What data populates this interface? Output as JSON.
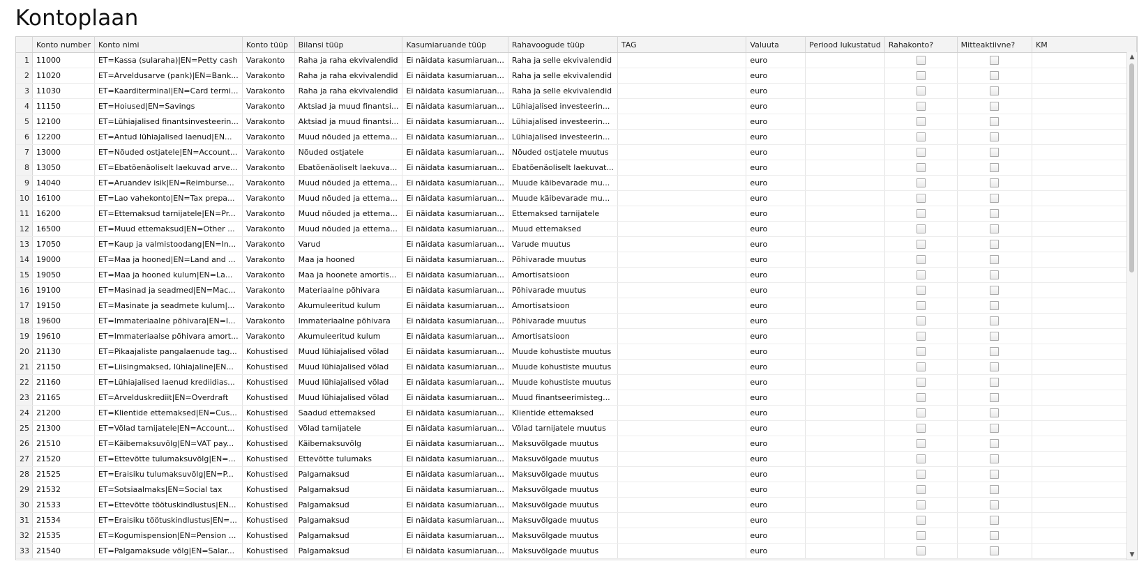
{
  "page": {
    "title": "Kontoplaan"
  },
  "columns": [
    "Konto number",
    "Konto nimi",
    "Konto tüüp",
    "Bilansi tüüp",
    "Kasumiaruande tüüp",
    "Rahavoogude tüüp",
    "TAG",
    "Valuuta",
    "Periood lukustatud",
    "Rahakonto?",
    "Mitteaktiivne?",
    "KM"
  ],
  "rows": [
    {
      "n": "1",
      "num": "11000",
      "name": "ET=Kassa (sularaha)|EN=Petty cash",
      "type": "Varakonto",
      "bal": "Raha ja raha ekvivalendid",
      "inc": "Ei näidata kasumiaruan...",
      "cf": "Raha ja selle ekvivalendid",
      "cur": "euro"
    },
    {
      "n": "2",
      "num": "11020",
      "name": "ET=Arveldusarve (pank)|EN=Bank...",
      "type": "Varakonto",
      "bal": "Raha ja raha ekvivalendid",
      "inc": "Ei näidata kasumiaruan...",
      "cf": "Raha ja selle ekvivalendid",
      "cur": "euro"
    },
    {
      "n": "3",
      "num": "11030",
      "name": "ET=Kaarditerminal|EN=Card termi...",
      "type": "Varakonto",
      "bal": "Raha ja raha ekvivalendid",
      "inc": "Ei näidata kasumiaruan...",
      "cf": "Raha ja selle ekvivalendid",
      "cur": "euro"
    },
    {
      "n": "4",
      "num": "11150",
      "name": "ET=Hoiused|EN=Savings",
      "type": "Varakonto",
      "bal": "Aktsiad ja muud finantsi...",
      "inc": "Ei näidata kasumiaruan...",
      "cf": "Lühiajalised investeerin...",
      "cur": "euro"
    },
    {
      "n": "5",
      "num": "12100",
      "name": "ET=Lühiajalised finantsinvesteerin...",
      "type": "Varakonto",
      "bal": "Aktsiad ja muud finantsi...",
      "inc": "Ei näidata kasumiaruan...",
      "cf": "Lühiajalised investeerin...",
      "cur": "euro"
    },
    {
      "n": "6",
      "num": "12200",
      "name": "ET=Antud lühiajalised laenud|EN...",
      "type": "Varakonto",
      "bal": "Muud nõuded ja ettema...",
      "inc": "Ei näidata kasumiaruan...",
      "cf": "Lühiajalised investeerin...",
      "cur": "euro"
    },
    {
      "n": "7",
      "num": "13000",
      "name": "ET=Nõuded ostjatele|EN=Account...",
      "type": "Varakonto",
      "bal": "Nõuded ostjatele",
      "inc": "Ei näidata kasumiaruan...",
      "cf": "Nõuded ostjatele muutus",
      "cur": "euro"
    },
    {
      "n": "8",
      "num": "13050",
      "name": "ET=Ebatõenäoliselt laekuvad arve...",
      "type": "Varakonto",
      "bal": "Ebatõenäoliselt laekuva...",
      "inc": "Ei näidata kasumiaruan...",
      "cf": "Ebatõenäoliselt laekuvat...",
      "cur": "euro"
    },
    {
      "n": "9",
      "num": "14040",
      "name": "ET=Aruandev isik|EN=Reimburse...",
      "type": "Varakonto",
      "bal": "Muud nõuded ja ettema...",
      "inc": "Ei näidata kasumiaruan...",
      "cf": "Muude käibevarade mu...",
      "cur": "euro"
    },
    {
      "n": "10",
      "num": "16100",
      "name": "ET=Lao vahekonto|EN=Tax prepa...",
      "type": "Varakonto",
      "bal": "Muud nõuded ja ettema...",
      "inc": "Ei näidata kasumiaruan...",
      "cf": "Muude käibevarade mu...",
      "cur": "euro"
    },
    {
      "n": "11",
      "num": "16200",
      "name": "ET=Ettemaksud tarnijatele|EN=Pr...",
      "type": "Varakonto",
      "bal": "Muud nõuded ja ettema...",
      "inc": "Ei näidata kasumiaruan...",
      "cf": "Ettemaksed tarnijatele",
      "cur": "euro"
    },
    {
      "n": "12",
      "num": "16500",
      "name": "ET=Muud ettemaksud|EN=Other ...",
      "type": "Varakonto",
      "bal": "Muud nõuded ja ettema...",
      "inc": "Ei näidata kasumiaruan...",
      "cf": "Muud ettemaksed",
      "cur": "euro"
    },
    {
      "n": "13",
      "num": "17050",
      "name": "ET=Kaup ja valmistoodang|EN=In...",
      "type": "Varakonto",
      "bal": "Varud",
      "inc": "Ei näidata kasumiaruan...",
      "cf": "Varude muutus",
      "cur": "euro"
    },
    {
      "n": "14",
      "num": "19000",
      "name": "ET=Maa ja hooned|EN=Land and ...",
      "type": "Varakonto",
      "bal": "Maa ja hooned",
      "inc": "Ei näidata kasumiaruan...",
      "cf": "Põhivarade muutus",
      "cur": "euro"
    },
    {
      "n": "15",
      "num": "19050",
      "name": "ET=Maa ja hooned kulum|EN=La...",
      "type": "Varakonto",
      "bal": "Maa ja hoonete amortis...",
      "inc": "Ei näidata kasumiaruan...",
      "cf": "Amortisatsioon",
      "cur": "euro"
    },
    {
      "n": "16",
      "num": "19100",
      "name": "ET=Masinad ja seadmed|EN=Mac...",
      "type": "Varakonto",
      "bal": "Materiaalne põhivara",
      "inc": "Ei näidata kasumiaruan...",
      "cf": "Põhivarade muutus",
      "cur": "euro"
    },
    {
      "n": "17",
      "num": "19150",
      "name": "ET=Masinate ja seadmete kulum|...",
      "type": "Varakonto",
      "bal": "Akumuleeritud kulum",
      "inc": "Ei näidata kasumiaruan...",
      "cf": "Amortisatsioon",
      "cur": "euro"
    },
    {
      "n": "18",
      "num": "19600",
      "name": "ET=Immateriaalne põhivara|EN=I...",
      "type": "Varakonto",
      "bal": "Immateriaalne põhivara",
      "inc": "Ei näidata kasumiaruan...",
      "cf": "Põhivarade muutus",
      "cur": "euro"
    },
    {
      "n": "19",
      "num": "19610",
      "name": "ET=Immateriaalse põhivara amort...",
      "type": "Varakonto",
      "bal": "Akumuleeritud kulum",
      "inc": "Ei näidata kasumiaruan...",
      "cf": "Amortisatsioon",
      "cur": "euro"
    },
    {
      "n": "20",
      "num": "21130",
      "name": "ET=Pikaajaliste pangalaenude tag...",
      "type": "Kohustised",
      "bal": "Muud lühiajalised võlad",
      "inc": "Ei näidata kasumiaruan...",
      "cf": "Muude kohustiste muutus",
      "cur": "euro"
    },
    {
      "n": "21",
      "num": "21150",
      "name": "ET=Liisingmaksed, lühiajaline|EN...",
      "type": "Kohustised",
      "bal": "Muud lühiajalised võlad",
      "inc": "Ei näidata kasumiaruan...",
      "cf": "Muude kohustiste muutus",
      "cur": "euro"
    },
    {
      "n": "22",
      "num": "21160",
      "name": "ET=Lühiajalised laenud krediidias...",
      "type": "Kohustised",
      "bal": "Muud lühiajalised võlad",
      "inc": "Ei näidata kasumiaruan...",
      "cf": "Muude kohustiste muutus",
      "cur": "euro"
    },
    {
      "n": "23",
      "num": "21165",
      "name": "ET=Arvelduskrediit|EN=Overdraft",
      "type": "Kohustised",
      "bal": "Muud lühiajalised võlad",
      "inc": "Ei näidata kasumiaruan...",
      "cf": "Muud finantseerimisteg...",
      "cur": "euro"
    },
    {
      "n": "24",
      "num": "21200",
      "name": "ET=Klientide ettemaksed|EN=Cus...",
      "type": "Kohustised",
      "bal": "Saadud ettemaksed",
      "inc": "Ei näidata kasumiaruan...",
      "cf": "Klientide ettemaksed",
      "cur": "euro"
    },
    {
      "n": "25",
      "num": "21300",
      "name": "ET=Võlad tarnijatele|EN=Account...",
      "type": "Kohustised",
      "bal": "Võlad tarnijatele",
      "inc": "Ei näidata kasumiaruan...",
      "cf": "Võlad tarnijatele muutus",
      "cur": "euro"
    },
    {
      "n": "26",
      "num": "21510",
      "name": "ET=Käibemaksuvõlg|EN=VAT pay...",
      "type": "Kohustised",
      "bal": "Käibemaksuvõlg",
      "inc": "Ei näidata kasumiaruan...",
      "cf": "Maksuvõlgade muutus",
      "cur": "euro"
    },
    {
      "n": "27",
      "num": "21520",
      "name": "ET=Ettevõtte tulumaksuvõlg|EN=...",
      "type": "Kohustised",
      "bal": "Ettevõtte tulumaks",
      "inc": "Ei näidata kasumiaruan...",
      "cf": "Maksuvõlgade muutus",
      "cur": "euro"
    },
    {
      "n": "28",
      "num": "21525",
      "name": "ET=Eraisiku tulumaksuvõlg|EN=P...",
      "type": "Kohustised",
      "bal": "Palgamaksud",
      "inc": "Ei näidata kasumiaruan...",
      "cf": "Maksuvõlgade muutus",
      "cur": "euro"
    },
    {
      "n": "29",
      "num": "21532",
      "name": "ET=Sotsiaalmaks|EN=Social tax",
      "type": "Kohustised",
      "bal": "Palgamaksud",
      "inc": "Ei näidata kasumiaruan...",
      "cf": "Maksuvõlgade muutus",
      "cur": "euro"
    },
    {
      "n": "30",
      "num": "21533",
      "name": "ET=Ettevõtte töötuskindlustus|EN...",
      "type": "Kohustised",
      "bal": "Palgamaksud",
      "inc": "Ei näidata kasumiaruan...",
      "cf": "Maksuvõlgade muutus",
      "cur": "euro"
    },
    {
      "n": "31",
      "num": "21534",
      "name": "ET=Eraisiku töötuskindlustus|EN=...",
      "type": "Kohustised",
      "bal": "Palgamaksud",
      "inc": "Ei näidata kasumiaruan...",
      "cf": "Maksuvõlgade muutus",
      "cur": "euro"
    },
    {
      "n": "32",
      "num": "21535",
      "name": "ET=Kogumispension|EN=Pension ...",
      "type": "Kohustised",
      "bal": "Palgamaksud",
      "inc": "Ei näidata kasumiaruan...",
      "cf": "Maksuvõlgade muutus",
      "cur": "euro"
    },
    {
      "n": "33",
      "num": "21540",
      "name": "ET=Palgamaksude võlg|EN=Salar...",
      "type": "Kohustised",
      "bal": "Palgamaksud",
      "inc": "Ei näidata kasumiaruan...",
      "cf": "Maksuvõlgade muutus",
      "cur": "euro"
    }
  ]
}
